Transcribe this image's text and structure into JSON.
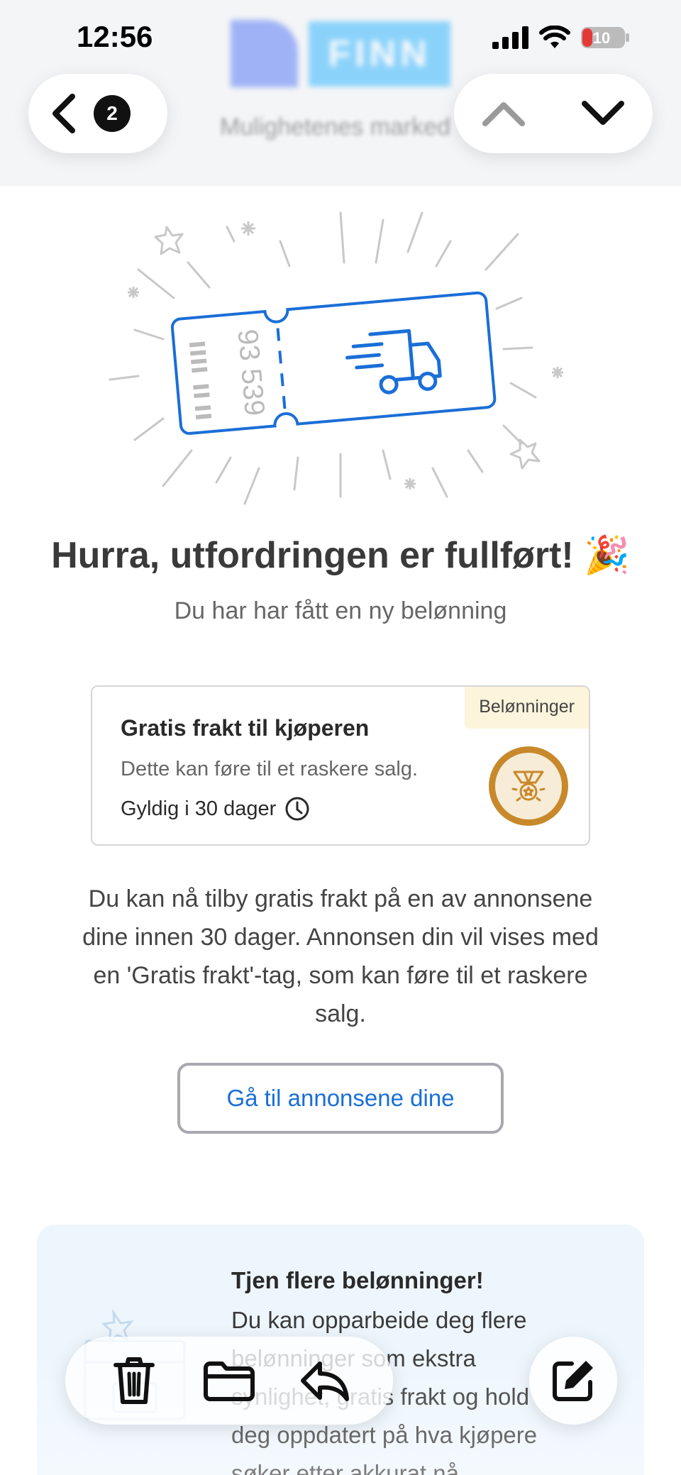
{
  "status": {
    "time": "12:56",
    "battery": "10"
  },
  "nav": {
    "unread_count": "2"
  },
  "header": {
    "brand": "FINN",
    "tagline": "Mulighetenes marked"
  },
  "hero": {
    "ticket_number": "93 539"
  },
  "headline": "Hurra, utfordringen er fullført! 🎉",
  "subline": "Du har har fått en ny belønning",
  "reward": {
    "tag": "Belønninger",
    "title": "Gratis frakt til kjøperen",
    "description": "Dette kan føre til et raskere salg.",
    "validity": "Gyldig i 30 dager"
  },
  "body_text": "Du kan nå tilby gratis frakt på en av annonsene dine innen 30 dager. Annonsen din vil vises med en 'Gratis frakt'-tag, som kan føre til et raskere salg.",
  "cta_label": "Gå til annonsene dine",
  "earn": {
    "title": "Tjen flere belønninger!",
    "body": "Du kan opparbeide deg flere belønninger som ekstra synlighet, gratis frakt og hold deg oppdatert på hva kjøpere søker etter akkurat nå."
  },
  "colors": {
    "ticket_blue": "#1a6ed8",
    "cta_text": "#1a6ed8",
    "medal_gold": "#c8892b",
    "tag_bg": "#fdf4dc",
    "earn_bg": "#eef6fd"
  },
  "icons": {
    "toolbar": [
      "trash-icon",
      "folder-icon",
      "reply-icon"
    ],
    "compose": "compose-icon"
  }
}
